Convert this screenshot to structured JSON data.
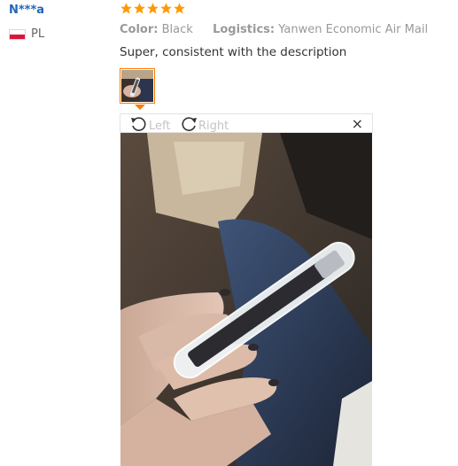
{
  "review": {
    "user_name": "N***a",
    "country_code": "PL",
    "rating": 5,
    "color_label": "Color:",
    "color_value": "Black",
    "logistics_label": "Logistics:",
    "logistics_value": "Yanwen Economic Air Mail",
    "text": "Super, consistent with the description"
  },
  "viewer": {
    "rotate_left_label": "Left",
    "rotate_right_label": "Right",
    "close_label": "×"
  },
  "colors": {
    "user_link": "#2365b9",
    "star": "#ff9900",
    "thumb_border": "#ff7a00",
    "flag_red": "#dc143c"
  },
  "icons": {
    "rotate_left": "rotate-left-icon",
    "rotate_right": "rotate-right-icon",
    "close": "close-icon",
    "star": "star-icon",
    "flag": "poland-flag-icon"
  }
}
